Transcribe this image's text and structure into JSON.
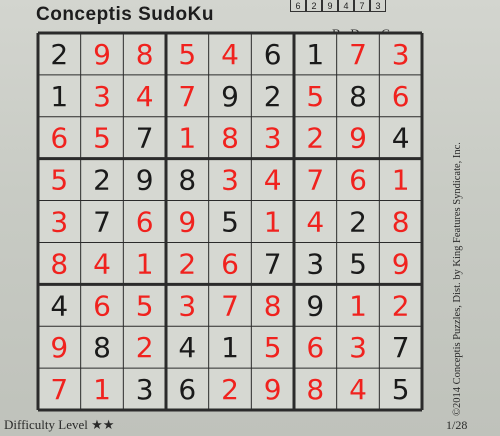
{
  "header": {
    "title": "Conceptis SudoKu",
    "byline": "By Dave Green",
    "previous_answer_strip": [
      "6",
      "2",
      "9",
      "4",
      "7",
      "3"
    ]
  },
  "footer": {
    "difficulty_label": "Difficulty Level",
    "difficulty_stars": "★★",
    "difficulty_rating": 2,
    "date": "1/28"
  },
  "credit": "©2014 Conceptis Puzzles, Dist. by King Features Syndicate, Inc.",
  "colors": {
    "given": "#1a1a1a",
    "handwritten": "#f0221e",
    "grid": "#2b2b2b"
  },
  "puzzle": {
    "rows": [
      [
        {
          "v": "2",
          "h": false
        },
        {
          "v": "9",
          "h": true
        },
        {
          "v": "8",
          "h": true
        },
        {
          "v": "5",
          "h": true
        },
        {
          "v": "4",
          "h": true
        },
        {
          "v": "6",
          "h": false
        },
        {
          "v": "1",
          "h": false
        },
        {
          "v": "7",
          "h": true
        },
        {
          "v": "3",
          "h": true
        }
      ],
      [
        {
          "v": "1",
          "h": false
        },
        {
          "v": "3",
          "h": true
        },
        {
          "v": "4",
          "h": true
        },
        {
          "v": "7",
          "h": true
        },
        {
          "v": "9",
          "h": false
        },
        {
          "v": "2",
          "h": false
        },
        {
          "v": "5",
          "h": true
        },
        {
          "v": "8",
          "h": false
        },
        {
          "v": "6",
          "h": true
        }
      ],
      [
        {
          "v": "6",
          "h": true
        },
        {
          "v": "5",
          "h": true
        },
        {
          "v": "7",
          "h": false
        },
        {
          "v": "1",
          "h": true
        },
        {
          "v": "8",
          "h": true
        },
        {
          "v": "3",
          "h": true
        },
        {
          "v": "2",
          "h": true
        },
        {
          "v": "9",
          "h": true
        },
        {
          "v": "4",
          "h": false
        }
      ],
      [
        {
          "v": "5",
          "h": true
        },
        {
          "v": "2",
          "h": false
        },
        {
          "v": "9",
          "h": false
        },
        {
          "v": "8",
          "h": false
        },
        {
          "v": "3",
          "h": true
        },
        {
          "v": "4",
          "h": true
        },
        {
          "v": "7",
          "h": true
        },
        {
          "v": "6",
          "h": true
        },
        {
          "v": "1",
          "h": true
        }
      ],
      [
        {
          "v": "3",
          "h": true
        },
        {
          "v": "7",
          "h": false
        },
        {
          "v": "6",
          "h": true
        },
        {
          "v": "9",
          "h": true
        },
        {
          "v": "5",
          "h": false
        },
        {
          "v": "1",
          "h": true
        },
        {
          "v": "4",
          "h": true
        },
        {
          "v": "2",
          "h": false
        },
        {
          "v": "8",
          "h": true
        }
      ],
      [
        {
          "v": "8",
          "h": true
        },
        {
          "v": "4",
          "h": true
        },
        {
          "v": "1",
          "h": true
        },
        {
          "v": "2",
          "h": true
        },
        {
          "v": "6",
          "h": true
        },
        {
          "v": "7",
          "h": false
        },
        {
          "v": "3",
          "h": false
        },
        {
          "v": "5",
          "h": false
        },
        {
          "v": "9",
          "h": true
        }
      ],
      [
        {
          "v": "4",
          "h": false
        },
        {
          "v": "6",
          "h": true
        },
        {
          "v": "5",
          "h": true
        },
        {
          "v": "3",
          "h": true
        },
        {
          "v": "7",
          "h": true
        },
        {
          "v": "8",
          "h": true
        },
        {
          "v": "9",
          "h": false
        },
        {
          "v": "1",
          "h": true
        },
        {
          "v": "2",
          "h": true
        }
      ],
      [
        {
          "v": "9",
          "h": true
        },
        {
          "v": "8",
          "h": false
        },
        {
          "v": "2",
          "h": true
        },
        {
          "v": "4",
          "h": false
        },
        {
          "v": "1",
          "h": false
        },
        {
          "v": "5",
          "h": true
        },
        {
          "v": "6",
          "h": true
        },
        {
          "v": "3",
          "h": true
        },
        {
          "v": "7",
          "h": false
        }
      ],
      [
        {
          "v": "7",
          "h": true
        },
        {
          "v": "1",
          "h": true
        },
        {
          "v": "3",
          "h": false
        },
        {
          "v": "6",
          "h": false
        },
        {
          "v": "2",
          "h": true
        },
        {
          "v": "9",
          "h": true
        },
        {
          "v": "8",
          "h": true
        },
        {
          "v": "4",
          "h": true
        },
        {
          "v": "5",
          "h": false
        }
      ]
    ]
  }
}
